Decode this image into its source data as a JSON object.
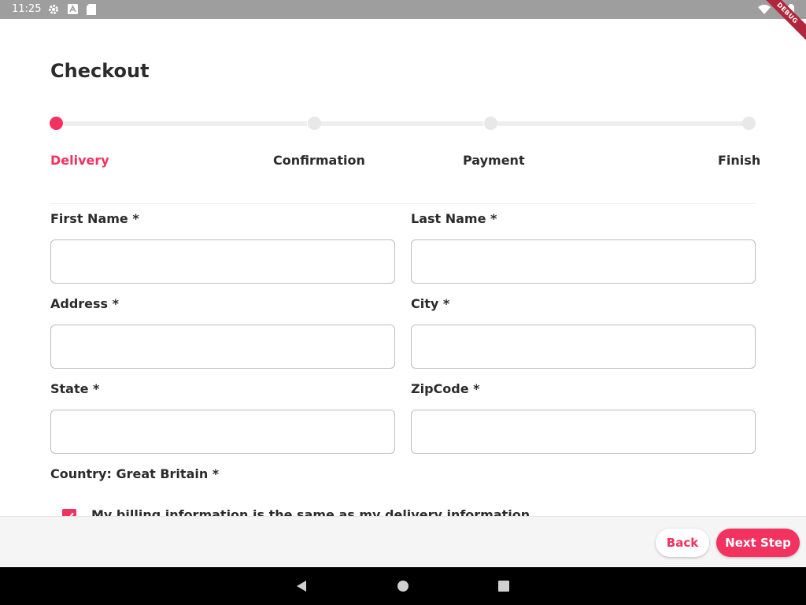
{
  "status_bar": {
    "time": "11:25",
    "left_icons": [
      "settings-icon",
      "app-store-icon",
      "sd-card-icon"
    ],
    "right_icons": [
      "wifi-icon",
      "battery-icon"
    ],
    "debug_banner": "DEBUG"
  },
  "page": {
    "title": "Checkout"
  },
  "stepper": {
    "accent_color": "#f2325f",
    "steps": [
      {
        "label": "Delivery",
        "active": true
      },
      {
        "label": "Confirmation",
        "active": false
      },
      {
        "label": "Payment",
        "active": false
      },
      {
        "label": "Finish",
        "active": false
      }
    ]
  },
  "form": {
    "first_name": {
      "label": "First Name *",
      "value": ""
    },
    "last_name": {
      "label": "Last Name *",
      "value": ""
    },
    "address": {
      "label": "Address *",
      "value": ""
    },
    "city": {
      "label": "City *",
      "value": ""
    },
    "state": {
      "label": "State *",
      "value": ""
    },
    "zipcode": {
      "label": "ZipCode *",
      "value": ""
    },
    "country": "Country: Great Britain *",
    "billing_same": {
      "label": "My billing information is the same as my delivery information",
      "checked": true
    }
  },
  "footer": {
    "back_label": "Back",
    "next_label": "Next Step"
  },
  "nav_bar": {
    "icons": [
      "back-triangle-icon",
      "home-circle-icon",
      "recents-square-icon"
    ]
  }
}
